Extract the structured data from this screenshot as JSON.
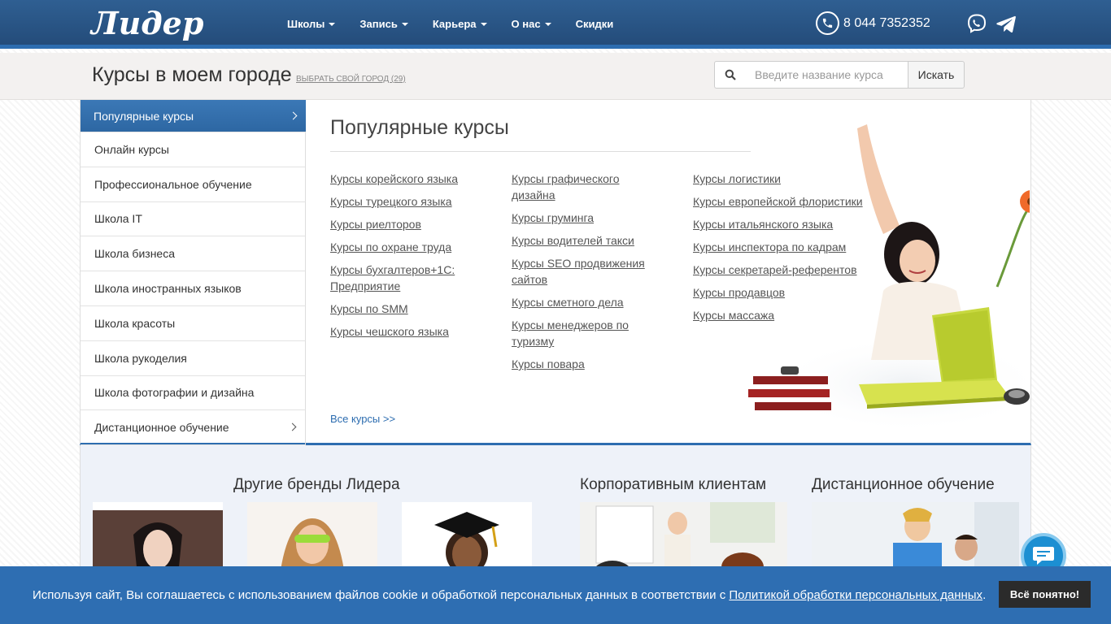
{
  "header": {
    "logo": "Лидер",
    "nav": [
      {
        "label": "Школы",
        "dropdown": true
      },
      {
        "label": "Запись",
        "dropdown": true
      },
      {
        "label": "Карьера",
        "dropdown": true
      },
      {
        "label": "О нас",
        "dropdown": true
      },
      {
        "label": "Скидки",
        "dropdown": false
      }
    ],
    "phone": "8 044 7352352"
  },
  "citybar": {
    "title": "Курсы в моем городе",
    "choose_city": "ВЫБРАТЬ СВОЙ ГОРОД (29)",
    "search_placeholder": "Введите название курса",
    "search_button": "Искать"
  },
  "sidebar": {
    "items": [
      {
        "label": "Популярные курсы",
        "active": true,
        "chevron": true
      },
      {
        "label": "Онлайн курсы",
        "active": false,
        "chevron": false
      },
      {
        "label": "Профессиональное обучение",
        "active": false,
        "chevron": false
      },
      {
        "label": "Школа IT",
        "active": false,
        "chevron": false
      },
      {
        "label": "Школа бизнеса",
        "active": false,
        "chevron": false
      },
      {
        "label": "Школа иностранных языков",
        "active": false,
        "chevron": false
      },
      {
        "label": "Школа красоты",
        "active": false,
        "chevron": false
      },
      {
        "label": "Школа рукоделия",
        "active": false,
        "chevron": false
      },
      {
        "label": "Школа фотографии и дизайна",
        "active": false,
        "chevron": false
      },
      {
        "label": "Дистанционное обучение",
        "active": false,
        "chevron": true
      }
    ]
  },
  "content": {
    "title": "Популярные курсы",
    "columns": [
      [
        "Курсы корейского языка",
        "Курсы турецкого языка",
        "Курсы риелторов",
        "Курсы по охране труда",
        "Курсы бухгалтеров+1С: Предприятие",
        "Курсы по SMM",
        "Курсы чешского языка"
      ],
      [
        "Курсы графического дизайна",
        "Курсы груминга",
        "Курсы водителей такси",
        "Курсы SEO продвижения сайтов",
        "Курсы сметного дела",
        "Курсы менеджеров по туризму",
        "Курсы повара"
      ],
      [
        "Курсы логистики",
        "Курсы европейской флористики",
        "Курсы итальянского языка",
        "Курсы инспектора по кадрам",
        "Курсы секретарей-референтов",
        "Курсы продавцов",
        "Курсы массажа"
      ]
    ],
    "all_courses": "Все курсы >>"
  },
  "bottom": {
    "brands_title": "Другие бренды Лидера",
    "corporate_title": "Корпоративным клиентам",
    "distance_title": "Дистанционное обучение"
  },
  "cookie": {
    "text": "Используя сайт, Вы соглашаетесь с использованием файлов cookie и обработкой персональных данных в соответствии с",
    "link": "Политикой обработки персональных данных",
    "period": ".",
    "button": "Всё понятно!"
  },
  "colors": {
    "header_bg": "#2a5685",
    "accent": "#2d6db0",
    "cookie_bg": "#2e6eb2",
    "chat_bubble": "#1c8fd2"
  }
}
